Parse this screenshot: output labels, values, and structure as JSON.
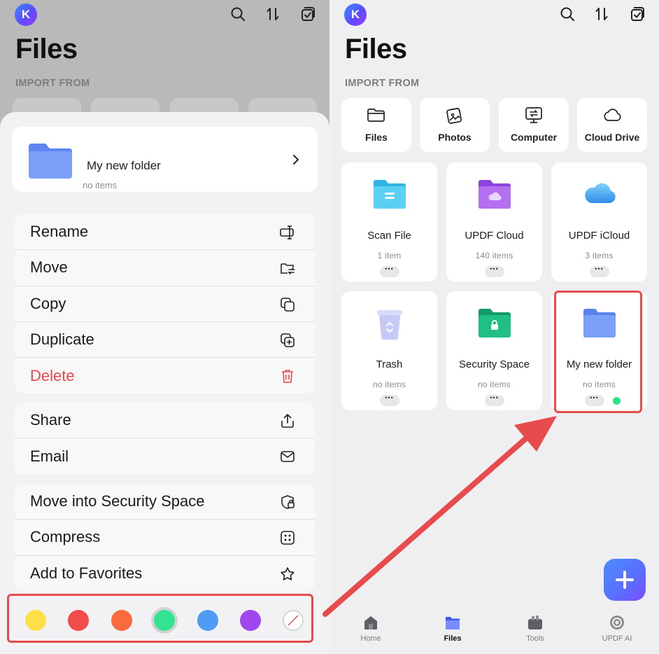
{
  "header": {
    "avatar_letter": "K",
    "title": "Files",
    "import_label": "IMPORT FROM",
    "icons": [
      "search-icon",
      "sort-icon",
      "select-icon"
    ]
  },
  "folder_sheet": {
    "folder_name": "My new folder",
    "folder_subtitle": "no items",
    "menu_groups": [
      [
        {
          "label": "Rename",
          "icon": "rename-icon"
        },
        {
          "label": "Move",
          "icon": "move-icon"
        },
        {
          "label": "Copy",
          "icon": "copy-icon"
        },
        {
          "label": "Duplicate",
          "icon": "duplicate-icon"
        },
        {
          "label": "Delete",
          "icon": "trash-icon",
          "danger": true
        }
      ],
      [
        {
          "label": "Share",
          "icon": "share-icon"
        },
        {
          "label": "Email",
          "icon": "email-icon"
        }
      ],
      [
        {
          "label": "Move into Security Space",
          "icon": "shield-lock-icon"
        },
        {
          "label": "Compress",
          "icon": "compress-icon"
        },
        {
          "label": "Add to Favorites",
          "icon": "star-icon"
        }
      ]
    ],
    "color_tags": [
      "#fde047",
      "#f24b4b",
      "#fb6a3c",
      "#34e38f",
      "#4e9cf5",
      "#a047ef",
      "none"
    ],
    "selected_color": "#34e38f"
  },
  "import_sources": [
    {
      "label": "Files",
      "icon": "folder-outline-icon"
    },
    {
      "label": "Photos",
      "icon": "photos-icon"
    },
    {
      "label": "Computer",
      "icon": "computer-icon"
    },
    {
      "label": "Cloud Drive",
      "icon": "cloud-outline-icon"
    }
  ],
  "folders": [
    {
      "name": "Scan File",
      "count": "1 item",
      "icon": "scan-folder-icon",
      "color": "#4cc7ee"
    },
    {
      "name": "UPDF Cloud",
      "count": "140 items",
      "icon": "cloud-folder-icon",
      "color": "#a35ce8"
    },
    {
      "name": "UPDF iCloud",
      "count": "3 items",
      "icon": "icloud-icon",
      "color": "#4aa8ee"
    },
    {
      "name": "Trash",
      "count": "no items",
      "icon": "trash-bin-icon",
      "color": "#c4c6f4"
    },
    {
      "name": "Security Space",
      "count": "no items",
      "icon": "lock-folder-icon",
      "color": "#1fb87a"
    },
    {
      "name": "My new folder",
      "count": "no items",
      "icon": "folder-icon",
      "color": "#6f96f5",
      "tag_color": "#2de38a"
    }
  ],
  "tabs": [
    {
      "label": "Home",
      "icon": "home-icon",
      "active": false
    },
    {
      "label": "Files",
      "icon": "files-icon",
      "active": true
    },
    {
      "label": "Tools",
      "icon": "tools-icon",
      "active": false
    },
    {
      "label": "UPDF AI",
      "icon": "ai-icon",
      "active": false
    }
  ],
  "annotation_color": "#e84b4b"
}
